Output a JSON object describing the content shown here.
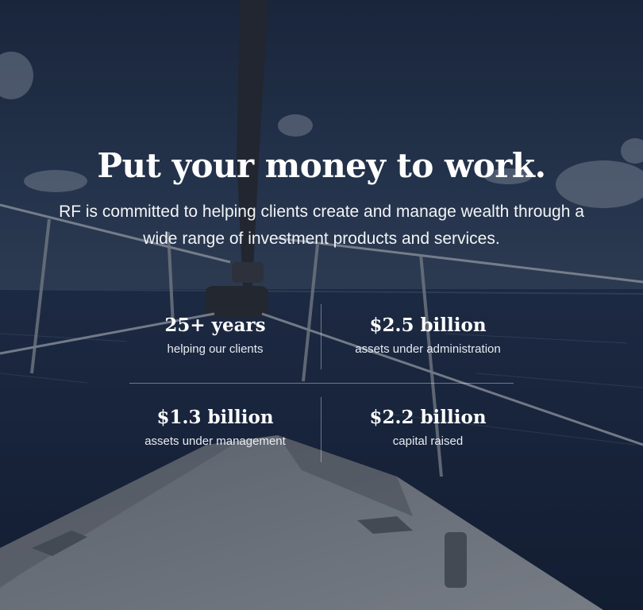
{
  "hero": {
    "headline": "Put your money to work.",
    "subheadline": "RF is committed to helping clients create and manage wealth through a wide range of investment products and services."
  },
  "stats": [
    {
      "value": "25+ years",
      "label": "helping our clients"
    },
    {
      "value": "$2.5 billion",
      "label": "assets under administration"
    },
    {
      "value": "$1.3 billion",
      "label": "assets under management"
    },
    {
      "value": "$2.2 billion",
      "label": "capital raised"
    }
  ],
  "colors": {
    "text": "#ffffff",
    "overlay": "#121826",
    "sky": "#223450",
    "sea": "#1b2840",
    "deck": "#8f949c"
  }
}
